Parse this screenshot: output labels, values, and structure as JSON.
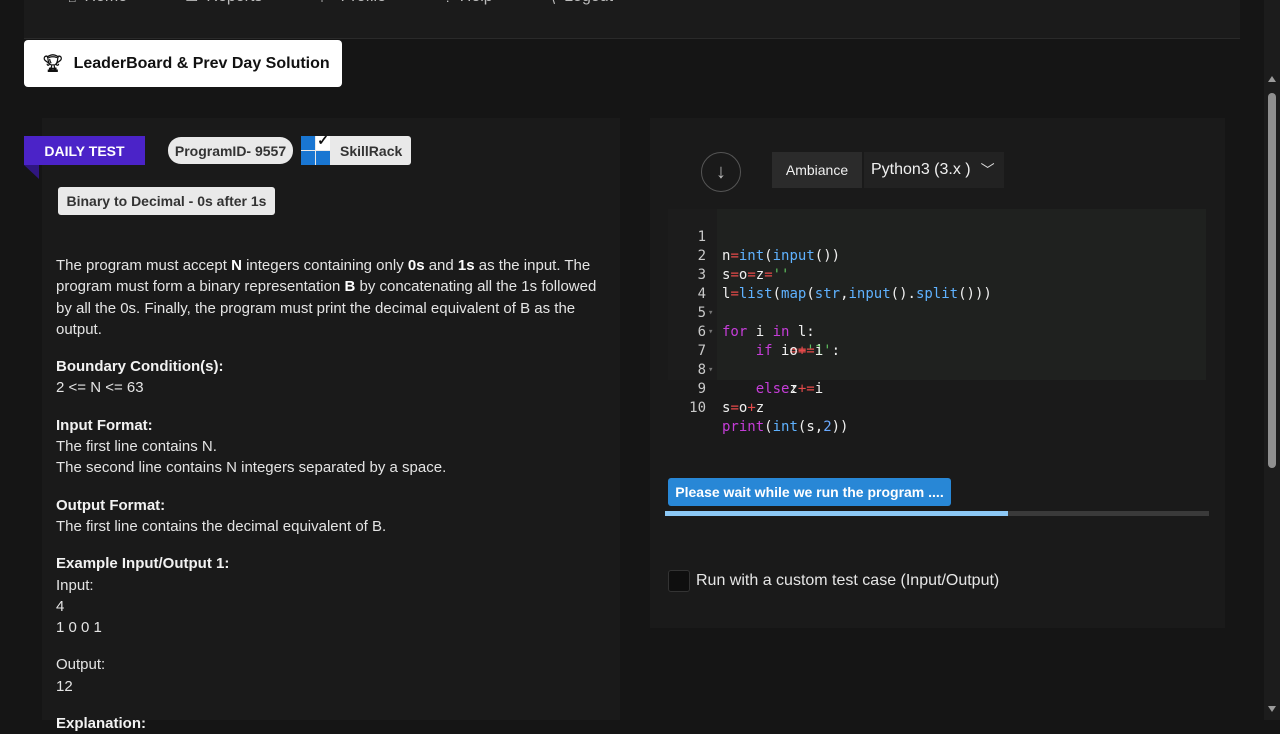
{
  "nav": {
    "items": [
      {
        "label": "Home",
        "icon": "home-icon",
        "glyph": "⌂"
      },
      {
        "label": "Reports",
        "icon": "reports-icon",
        "glyph": "▭"
      },
      {
        "label": "Profile",
        "icon": "profile-icon",
        "glyph": "⊢"
      },
      {
        "label": "Help",
        "icon": "help-icon",
        "glyph": "?"
      },
      {
        "label": "Logout",
        "icon": "logout-icon",
        "glyph": "⟨"
      }
    ]
  },
  "leaderboard": {
    "label": "LeaderBoard & Prev Day Solution",
    "icon": "trophy-icon"
  },
  "badges": {
    "daily": "DAILY TEST",
    "program_id": "ProgramID- 9557",
    "brand": "SkillRack",
    "problem_title": "Binary to Decimal - 0s after 1s"
  },
  "problem": {
    "desc_1": "The program must accept ",
    "desc_N": "N",
    "desc_2": " integers containing only ",
    "desc_0s": "0s",
    "desc_3": " and ",
    "desc_1s": "1s",
    "desc_4": " as the input. The program must form a binary representation ",
    "desc_B": "B",
    "desc_5": " by concatenating all the 1s followed by all the 0s. Finally, the program must print the decimal equivalent of B as the output.",
    "boundary_head": "Boundary Condition(s):",
    "boundary_text": "2 <= N <= 63",
    "input_head": "Input Format:",
    "input_line1": "The first line contains N.",
    "input_line2": "The second line contains N integers separated by a space.",
    "output_head": "Output Format:",
    "output_line1": "The first line contains the decimal equivalent of B.",
    "example_head": "Example Input/Output 1:",
    "example_input_label": "Input:",
    "example_input_1": "4",
    "example_input_2": "1 0 0 1",
    "example_output_label": "Output:",
    "example_output_1": "12",
    "explanation_partial": "Explanation:"
  },
  "editor": {
    "ambiance_label": "Ambiance",
    "language": "Python3 (3.x )",
    "line_numbers": [
      "1",
      "2",
      "3",
      "4",
      "5",
      "6",
      "7",
      "8",
      "9",
      "10"
    ]
  },
  "run": {
    "status": "Please wait while we run the program ....",
    "progress": 0.63,
    "custom_label": "Run with a custom test case (Input/Output)"
  }
}
